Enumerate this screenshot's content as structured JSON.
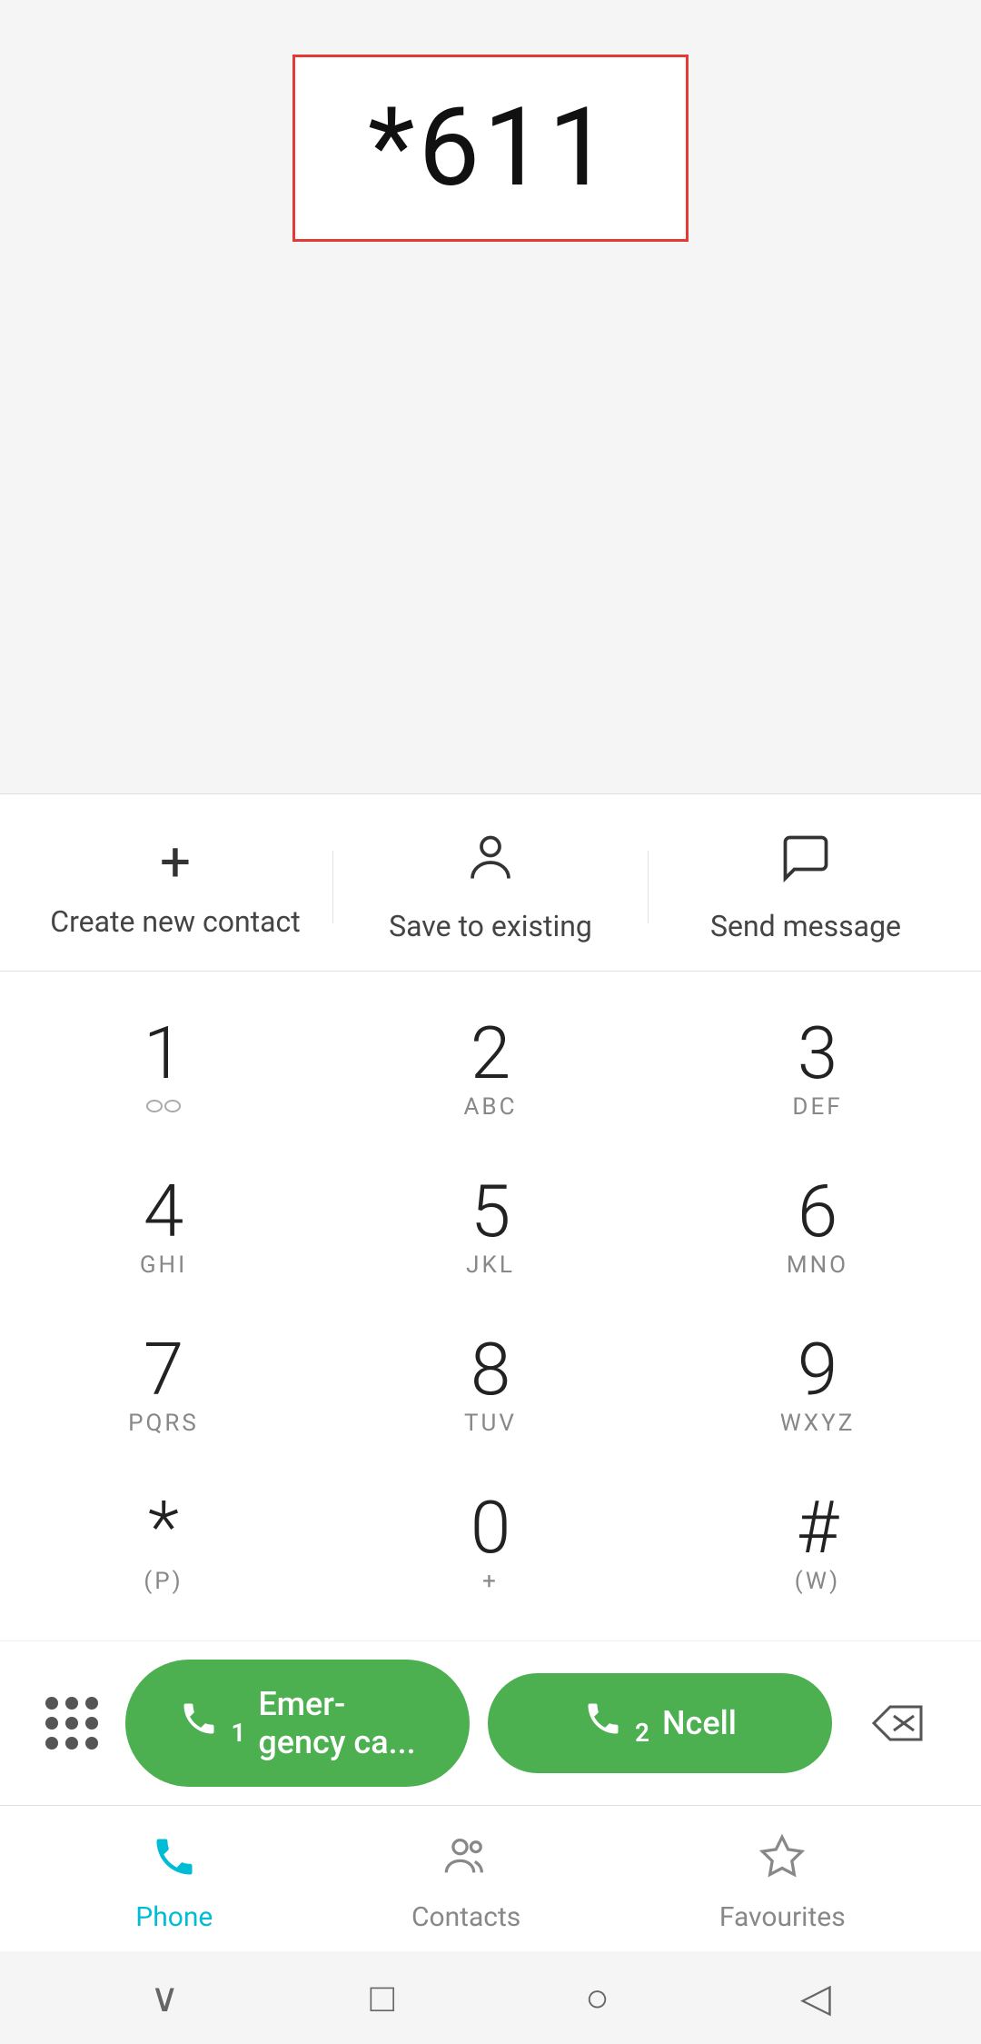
{
  "dialed_number": "*611",
  "contact_actions": [
    {
      "id": "create-new-contact",
      "icon": "+",
      "label": "Create new contact"
    },
    {
      "id": "save-to-existing",
      "icon": "person",
      "label": "Save to existing"
    },
    {
      "id": "send-message",
      "icon": "chat",
      "label": "Send message"
    }
  ],
  "dialpad": [
    {
      "number": "1",
      "letters": "○○"
    },
    {
      "number": "2",
      "letters": "ABC"
    },
    {
      "number": "3",
      "letters": "DEF"
    },
    {
      "number": "4",
      "letters": "GHI"
    },
    {
      "number": "5",
      "letters": "JKL"
    },
    {
      "number": "6",
      "letters": "MNO"
    },
    {
      "number": "7",
      "letters": "PQRS"
    },
    {
      "number": "8",
      "letters": "TUV"
    },
    {
      "number": "9",
      "letters": "WXYZ"
    },
    {
      "number": "*",
      "letters": "(P)"
    },
    {
      "number": "0",
      "letters": "+"
    },
    {
      "number": "#",
      "letters": "(W)"
    }
  ],
  "call_buttons": [
    {
      "id": "emergency-call",
      "sim": "1",
      "label": "Emer-\ngency ca..."
    },
    {
      "id": "ncell-call",
      "sim": "2",
      "label": "Ncell"
    }
  ],
  "bottom_nav": [
    {
      "id": "phone",
      "label": "Phone",
      "active": true
    },
    {
      "id": "contacts",
      "label": "Contacts",
      "active": false
    },
    {
      "id": "favourites",
      "label": "Favourites",
      "active": false
    }
  ],
  "system_nav": {
    "back_label": "◁",
    "home_label": "○",
    "recents_label": "□",
    "notifications_label": "∨"
  }
}
